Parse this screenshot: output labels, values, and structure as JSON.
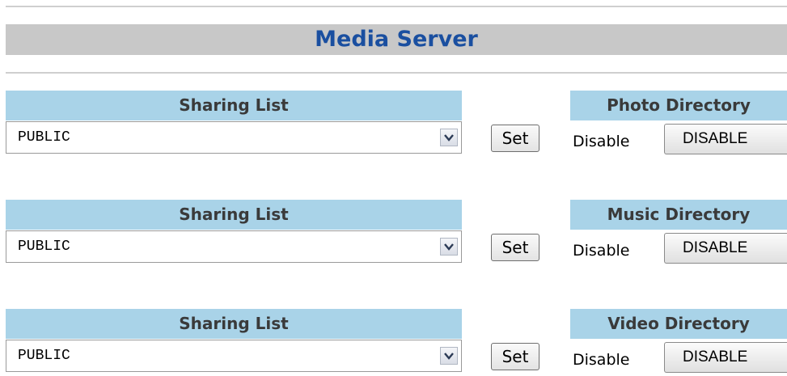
{
  "title": "Media Server",
  "sections": [
    {
      "list_header": "Sharing List",
      "selected_share": "PUBLIC",
      "set_label": "Set",
      "directory_header": "Photo Directory",
      "status": "Disable",
      "toggle_label": "DISABLE"
    },
    {
      "list_header": "Sharing List",
      "selected_share": "PUBLIC",
      "set_label": "Set",
      "directory_header": "Music Directory",
      "status": "Disable",
      "toggle_label": "DISABLE"
    },
    {
      "list_header": "Sharing List",
      "selected_share": "PUBLIC",
      "set_label": "Set",
      "directory_header": "Video Directory",
      "status": "Disable",
      "toggle_label": "DISABLE"
    }
  ],
  "icons": {
    "dropdown": "chevron-down-icon"
  },
  "colors": {
    "title_text": "#1a4fa0",
    "title_bar": "#c8c8c8",
    "section_header": "#a9d3e8"
  }
}
